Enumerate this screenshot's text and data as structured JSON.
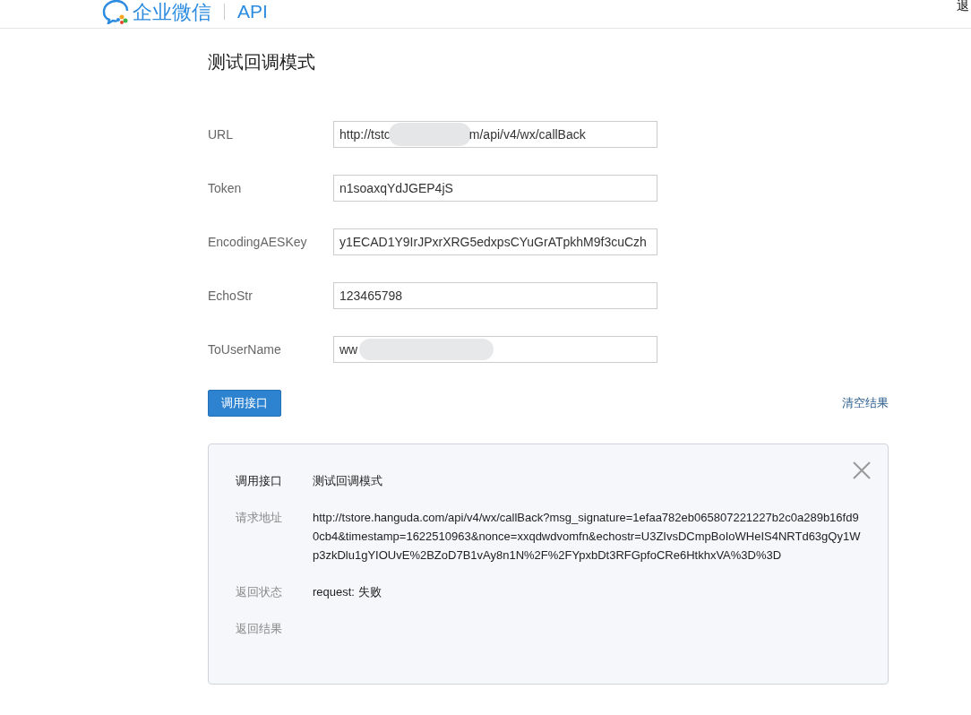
{
  "header": {
    "logo_text": "企业微信",
    "section": "API",
    "logout": "退"
  },
  "title": "测试回调模式",
  "fields": [
    {
      "label": "URL",
      "value": "http://tstc",
      "value_end": "m/api/v4/wx/callBack",
      "redacted": true
    },
    {
      "label": "Token",
      "value": "n1soaxqYdJGEP4jS",
      "redacted": false
    },
    {
      "label": "EncodingAESKey",
      "value": "y1ECAD1Y9IrJPxrXRG5edxpsCYuGrATpkhM9f3cuCzh",
      "redacted": false
    },
    {
      "label": "EchoStr",
      "value": "123465798",
      "redacted": false
    },
    {
      "label": "ToUserName",
      "value": "ww",
      "redacted": true
    }
  ],
  "call_button": "调用接口",
  "clear_link": "清空结果",
  "result": {
    "rows": [
      {
        "label": "调用接口",
        "value": "测试回调模式",
        "kind": "title"
      },
      {
        "label": "请求地址",
        "value": "http://tstore.hanguda.com/api/v4/wx/callBack?msg_signature=1efaa782eb065807221227b2c0a289b16fd90cb4&timestamp=1622510963&nonce=xxqdwdvomfn&echostr=U3ZIvsDCmpBoIoWHeIS4NRTd63gQy1Wp3zkDlu1gYIOUvE%2BZoD7B1vAy8n1N%2F%2FYpxbDt3RFGpfoCRe6HtkhxVA%3D%3D",
        "kind": "normal"
      },
      {
        "label": "返回状态",
        "value": "request: 失败",
        "kind": "normal"
      },
      {
        "label": "返回结果",
        "kind": "normal"
      }
    ]
  }
}
